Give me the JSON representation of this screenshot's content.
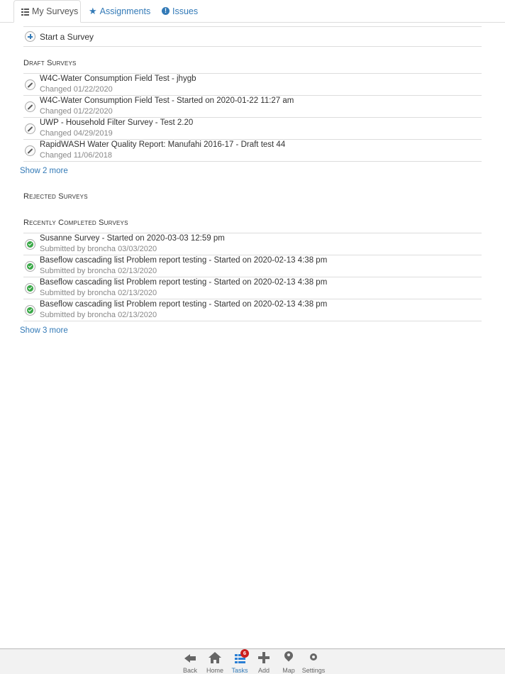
{
  "tabs": [
    {
      "label": "My Surveys",
      "icon": "list-icon",
      "active": true
    },
    {
      "label": "Assignments",
      "icon": "star-icon",
      "active": false
    },
    {
      "label": "Issues",
      "icon": "exclamation-icon",
      "active": false
    }
  ],
  "start_survey": {
    "label": "Start a Survey",
    "icon": "plus-circle-icon"
  },
  "sections": {
    "draft": {
      "title": "Draft Surveys",
      "items": [
        {
          "title": "W4C-Water Consumption Field Test - jhygb",
          "subtitle": "Changed 01/22/2020",
          "icon": "pencil-icon"
        },
        {
          "title": "W4C-Water Consumption Field Test - Started on 2020-01-22 11:27 am",
          "subtitle": "Changed 01/22/2020",
          "icon": "pencil-icon"
        },
        {
          "title": "UWP - Household Filter Survey - Test 2.20",
          "subtitle": "Changed 04/29/2019",
          "icon": "pencil-icon"
        },
        {
          "title": "RapidWASH Water Quality Report: Manufahi 2016-17 - Draft test 44",
          "subtitle": "Changed 11/06/2018",
          "icon": "pencil-icon"
        }
      ],
      "show_more": "Show 2 more"
    },
    "rejected": {
      "title": "Rejected Surveys"
    },
    "completed": {
      "title": "Recently Completed Surveys",
      "items": [
        {
          "title": "Susanne Survey - Started on 2020-03-03 12:59 pm",
          "subtitle": "Submitted by broncha 03/03/2020",
          "icon": "check-circle-icon"
        },
        {
          "title": "Baseflow cascading list Problem report testing - Started on 2020-02-13 4:38 pm",
          "subtitle": "Submitted by broncha 02/13/2020",
          "icon": "check-circle-icon"
        },
        {
          "title": "Baseflow cascading list Problem report testing - Started on 2020-02-13 4:38 pm",
          "subtitle": "Submitted by broncha 02/13/2020",
          "icon": "check-circle-icon"
        },
        {
          "title": "Baseflow cascading list Problem report testing - Started on 2020-02-13 4:38 pm",
          "subtitle": "Submitted by broncha 02/13/2020",
          "icon": "check-circle-icon"
        }
      ],
      "show_more": "Show 3 more"
    }
  },
  "toolbar": {
    "buttons": [
      {
        "label": "Back",
        "icon": "back-arrow-icon",
        "active": false
      },
      {
        "label": "Home",
        "icon": "home-icon",
        "active": false
      },
      {
        "label": "Tasks",
        "icon": "tasks-icon",
        "active": true,
        "badge": "6"
      },
      {
        "label": "Add",
        "icon": "plus-icon",
        "active": false
      },
      {
        "label": "Map",
        "icon": "map-pin-icon",
        "active": false
      },
      {
        "label": "Settings",
        "icon": "gear-icon",
        "active": false
      }
    ]
  },
  "colors": {
    "link": "#337ab7",
    "check_green": "#38a846",
    "badge_red": "#cc1f1f",
    "toolbar_bg": "#f2f2f2"
  }
}
